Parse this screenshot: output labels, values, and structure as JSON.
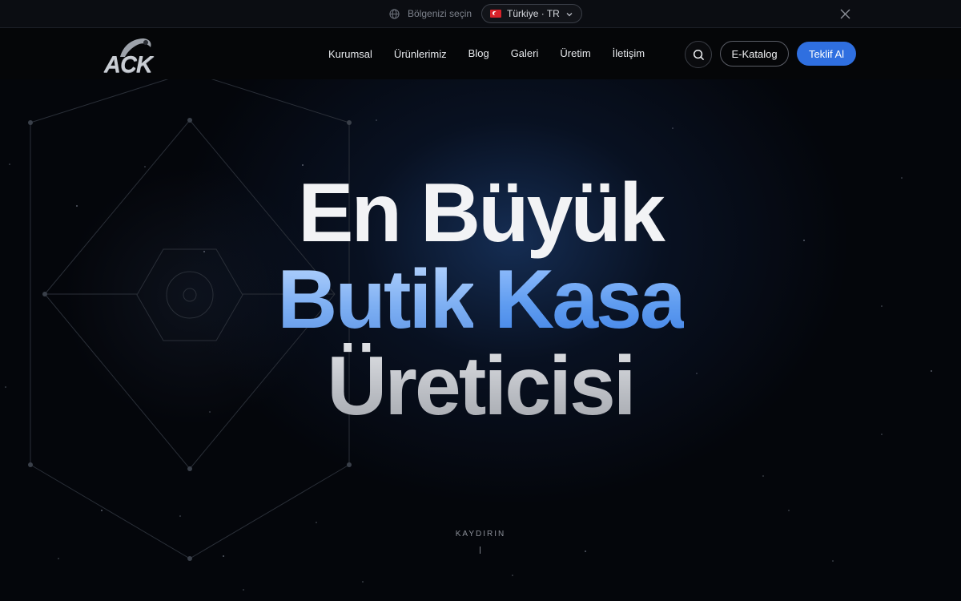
{
  "region_bar": {
    "label": "Bölgenizi seçin",
    "selected_region": "Türkiye · TR",
    "icons": {
      "globe": "globe-icon",
      "flag": "turkey-flag-icon",
      "chevron": "chevron-down-icon",
      "close": "close-icon"
    }
  },
  "header": {
    "logo_text": "ACK",
    "nav": [
      {
        "label": "Kurumsal"
      },
      {
        "label": "Ürünlerimiz"
      },
      {
        "label": "Blog"
      },
      {
        "label": "Galeri"
      },
      {
        "label": "Üretim"
      },
      {
        "label": "İletişim"
      }
    ],
    "search_icon": "search-icon",
    "ekatalog_label": "E-Katalog",
    "teklif_label": "Teklif Al",
    "accent_color": "#2f6fe0"
  },
  "hero": {
    "line1": "En Büyük",
    "line2_part1": "Butik",
    "line2_part2": "Kasa",
    "line3": "Üreticisi",
    "scroll_label": "KAYDIRIN"
  }
}
